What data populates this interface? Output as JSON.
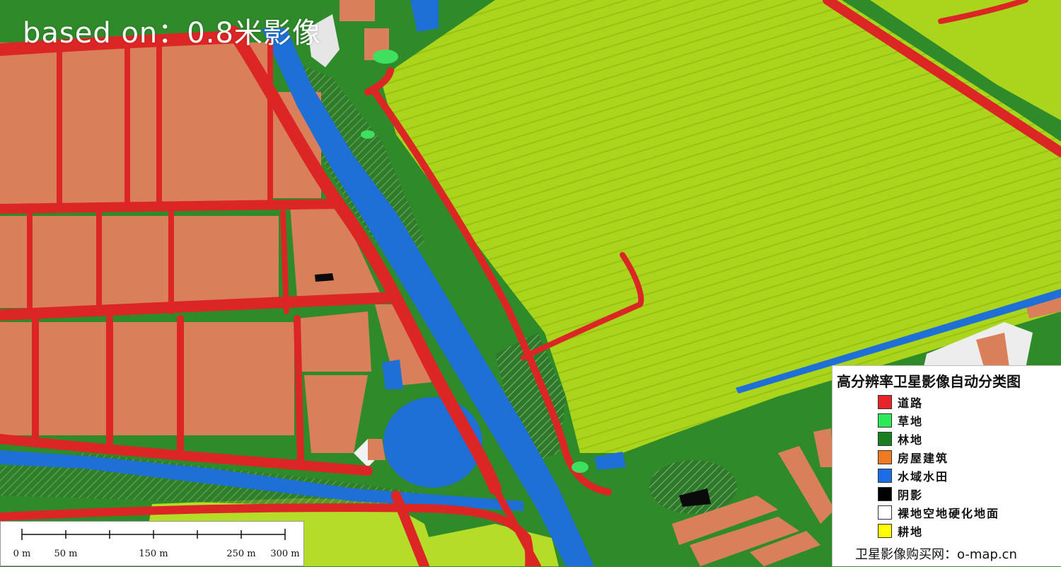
{
  "overlay": {
    "title": "based on：0.8米影像"
  },
  "legend": {
    "title": "高分辨率卫星影像自动分类图",
    "items": [
      {
        "label": "道路",
        "color": "#e8242a"
      },
      {
        "label": "草地",
        "color": "#2fe858"
      },
      {
        "label": "林地",
        "color": "#1a7f1f"
      },
      {
        "label": "房屋建筑",
        "color": "#f07a22"
      },
      {
        "label": "水域水田",
        "color": "#1d6ee6"
      },
      {
        "label": "阴影",
        "color": "#000000"
      },
      {
        "label": "裸地空地硬化地面",
        "color": "#ffffff"
      },
      {
        "label": "耕地",
        "color": "#ffff00"
      }
    ],
    "footer": "卫星影像购买网：o-map.cn"
  },
  "scalebar": {
    "labels": [
      "0 m",
      "50 m",
      "150 m",
      "250 m",
      "300 m"
    ]
  },
  "map_colors": {
    "road": "#dc2626",
    "building": "#d98058",
    "forest": "#2f8a2a",
    "cropland": "#a9d418",
    "water": "#1e6fd6",
    "bare": "#e8e8e8"
  }
}
